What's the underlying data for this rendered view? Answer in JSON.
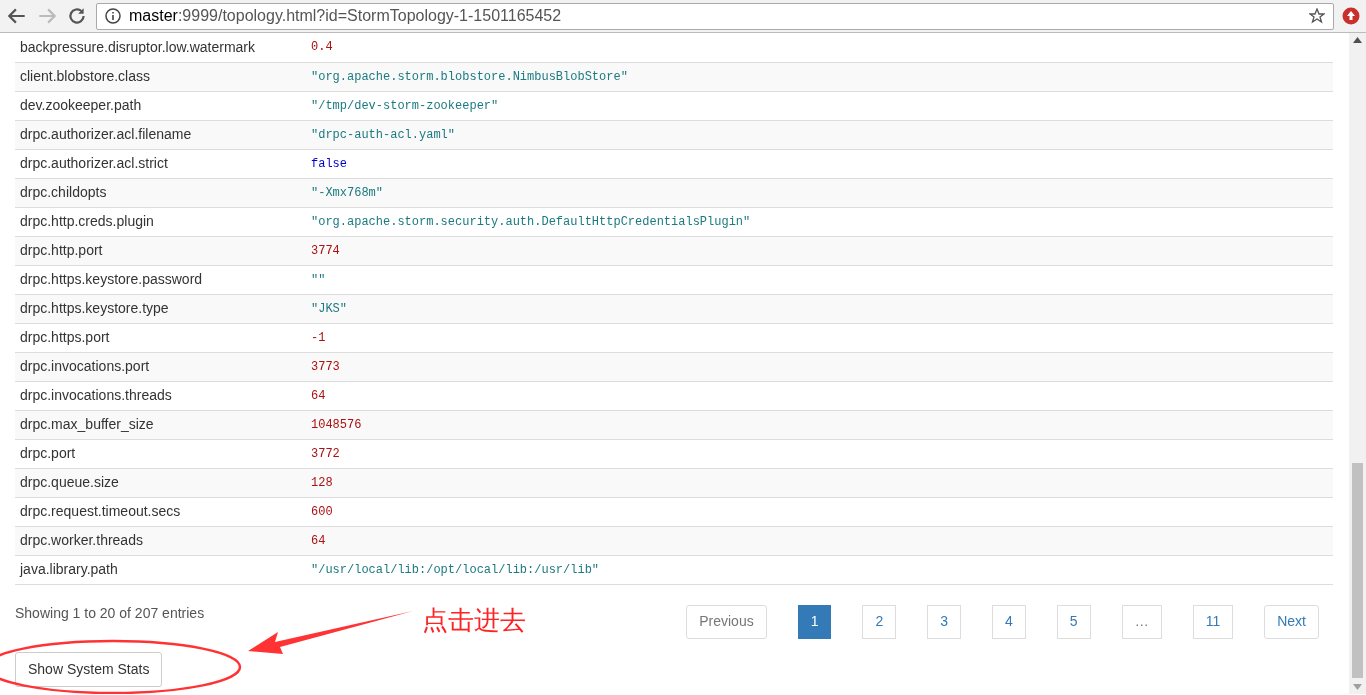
{
  "browser": {
    "url_host": "master",
    "url_rest": ":9999/topology.html?id=StormTopology-1-1501165452"
  },
  "config_table": {
    "rows": [
      {
        "key": "backpressure.disruptor.low.watermark",
        "value": "0.4",
        "kind": "number"
      },
      {
        "key": "client.blobstore.class",
        "value": "\"org.apache.storm.blobstore.NimbusBlobStore\"",
        "kind": "string"
      },
      {
        "key": "dev.zookeeper.path",
        "value": "\"/tmp/dev-storm-zookeeper\"",
        "kind": "string"
      },
      {
        "key": "drpc.authorizer.acl.filename",
        "value": "\"drpc-auth-acl.yaml\"",
        "kind": "string"
      },
      {
        "key": "drpc.authorizer.acl.strict",
        "value": "false",
        "kind": "boolean"
      },
      {
        "key": "drpc.childopts",
        "value": "\"-Xmx768m\"",
        "kind": "string"
      },
      {
        "key": "drpc.http.creds.plugin",
        "value": "\"org.apache.storm.security.auth.DefaultHttpCredentialsPlugin\"",
        "kind": "string"
      },
      {
        "key": "drpc.http.port",
        "value": "3774",
        "kind": "number"
      },
      {
        "key": "drpc.https.keystore.password",
        "value": "\"\"",
        "kind": "string"
      },
      {
        "key": "drpc.https.keystore.type",
        "value": "\"JKS\"",
        "kind": "string"
      },
      {
        "key": "drpc.https.port",
        "value": "-1",
        "kind": "number"
      },
      {
        "key": "drpc.invocations.port",
        "value": "3773",
        "kind": "number"
      },
      {
        "key": "drpc.invocations.threads",
        "value": "64",
        "kind": "number"
      },
      {
        "key": "drpc.max_buffer_size",
        "value": "1048576",
        "kind": "number"
      },
      {
        "key": "drpc.port",
        "value": "3772",
        "kind": "number"
      },
      {
        "key": "drpc.queue.size",
        "value": "128",
        "kind": "number"
      },
      {
        "key": "drpc.request.timeout.secs",
        "value": "600",
        "kind": "number"
      },
      {
        "key": "drpc.worker.threads",
        "value": "64",
        "kind": "number"
      },
      {
        "key": "java.library.path",
        "value": "\"/usr/local/lib:/opt/local/lib:/usr/lib\"",
        "kind": "string"
      }
    ]
  },
  "info": "Showing 1 to 20 of 207 entries",
  "pagination": [
    {
      "label": "Previous",
      "selected": false,
      "disabled": true
    },
    {
      "label": "1",
      "selected": true,
      "disabled": false
    },
    {
      "label": "2",
      "selected": false,
      "disabled": false
    },
    {
      "label": "3",
      "selected": false,
      "disabled": false
    },
    {
      "label": "4",
      "selected": false,
      "disabled": false
    },
    {
      "label": "5",
      "selected": false,
      "disabled": false
    },
    {
      "label": "…",
      "selected": false,
      "disabled": true
    },
    {
      "label": "11",
      "selected": false,
      "disabled": false
    },
    {
      "label": "Next",
      "selected": false,
      "disabled": false
    }
  ],
  "system_stats_button": "Show System Stats",
  "annotation": {
    "text": "点击进去"
  }
}
